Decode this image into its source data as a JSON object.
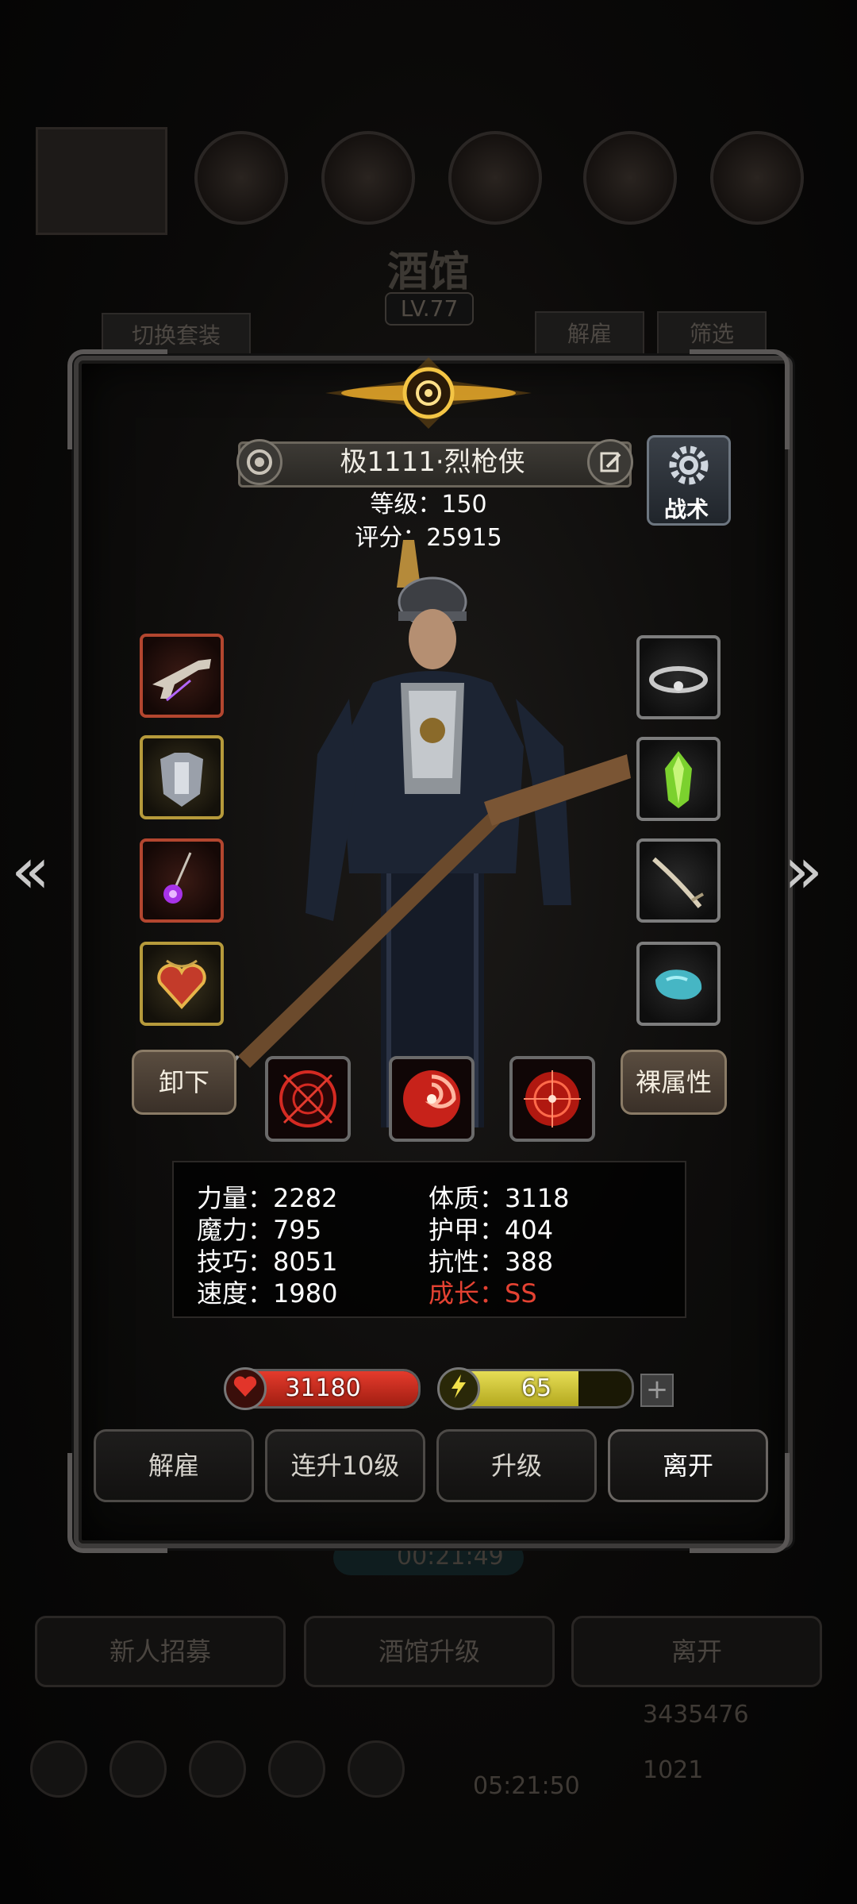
{
  "background": {
    "title": "酒馆",
    "level": "LV.77",
    "switch_outfit": "切换套装",
    "dismiss": "解雇",
    "filter": "筛选",
    "timer": "00:21:49",
    "bottom_buttons": [
      "新人招募",
      "酒馆升级",
      "离开"
    ],
    "gold": "3435476",
    "gems": "1021",
    "countdown": "05:21:50"
  },
  "hero": {
    "name": "极1111·烈枪侠",
    "level_label": "等级：150",
    "score_label": "评分：25915",
    "tactics_label": "战术"
  },
  "equipment": {
    "left": [
      "flintlock-pistol",
      "steel-armor",
      "purple-amulet",
      "heart-locket"
    ],
    "right": [
      "silver-circlet",
      "green-crystal",
      "bone-sabre",
      "turquoise-stone"
    ]
  },
  "buttons": {
    "unequip": "卸下",
    "base_attributes": "裸属性"
  },
  "skills": [
    "crosshair-skill",
    "vortex-skill",
    "target-skill"
  ],
  "stats": {
    "strength": "力量：2282",
    "magic": "魔力：795",
    "skill": "技巧：8051",
    "speed": "速度：1980",
    "constitution": "体质：3118",
    "armor": "护甲：404",
    "resistance": "抗性：388",
    "growth": "成长：SS"
  },
  "hp": {
    "value": "31180",
    "fill_fraction": 1.0
  },
  "energy": {
    "value": "65",
    "fill_fraction": 0.72
  },
  "actions": [
    "解雇",
    "连升10级",
    "升级",
    "离开"
  ],
  "colors": {
    "growth": "#e44232",
    "hp": "#d9301f",
    "energy": "#d2c73a"
  }
}
